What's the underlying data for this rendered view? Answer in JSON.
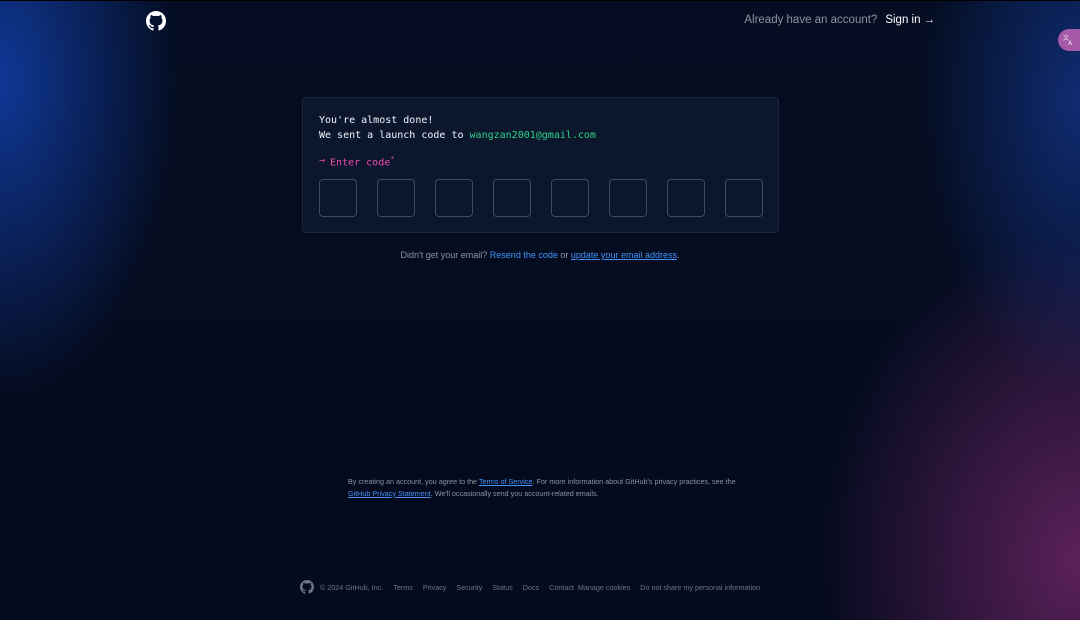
{
  "header": {
    "prompt": "Already have an account?",
    "signin_label": "Sign in",
    "signin_arrow": "→"
  },
  "translate": {
    "icon": "translate-icon"
  },
  "card": {
    "line1": "You're almost done!",
    "line2_prefix": "We sent a launch code to",
    "email": "wangzan2001@gmail.com",
    "prompt_arrow": "→",
    "prompt_label": "Enter code",
    "prompt_required": "*",
    "code_boxes": 8
  },
  "resend": {
    "question": "Didn't get your email?",
    "resend_link": "Resend the code",
    "or": "or",
    "update_link": "update your email address",
    "period": "."
  },
  "terms": {
    "t1": "By creating an account, you agree to the",
    "terms_link": "Terms of Service",
    "t2": ". For more information about GitHub's privacy practices, see the",
    "privacy_link": "GitHub Privacy Statement",
    "t3": ". We'll occasionally send you account-related emails."
  },
  "footer": {
    "copyright": "© 2024 GitHub, Inc.",
    "links": [
      "Terms",
      "Privacy",
      "Security",
      "Status",
      "Docs",
      "Contact",
      "Manage cookies",
      "Do not share my personal information"
    ]
  },
  "colors": {
    "background": "#040d21",
    "accent_green": "#2fd487",
    "accent_pink": "#ea4aaa",
    "link_blue": "#4493f8"
  }
}
